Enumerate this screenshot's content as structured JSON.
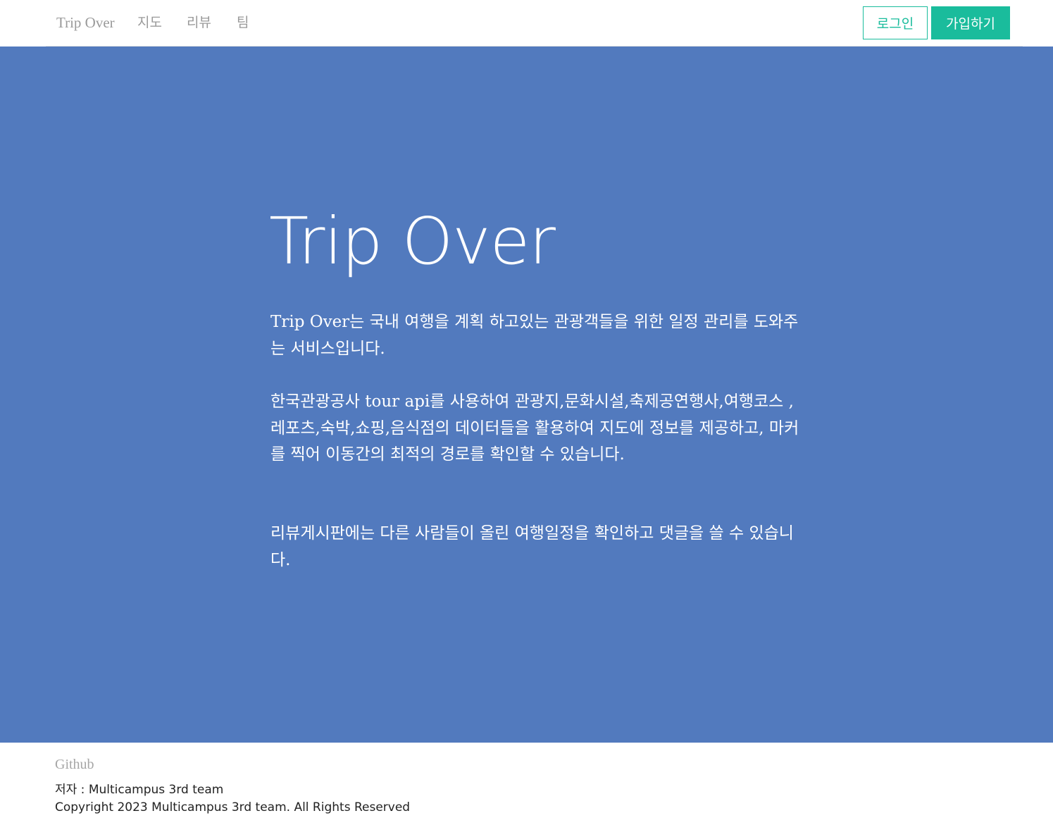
{
  "nav": {
    "brand": "Trip Over",
    "links": [
      "지도",
      "리뷰",
      "팀"
    ],
    "login_label": "로그인",
    "signup_label": "가입하기",
    "accent_color": "#1abc9c"
  },
  "hero": {
    "background_color": "#527abe",
    "title": "Trip Over",
    "paragraphs": [
      "Trip Over는 국내 여행을 계획 하고있는 관광객들을 위한 일정 관리를 도와주는 서비스입니다.",
      "한국관광공사 tour api를 사용하여 관광지,문화시설,축제공연행사,여행코스 ,레포츠,숙박,쇼핑,음식점의 데이터들을 활용하여 지도에 정보를 제공하고, 마커를 찍어 이동간의 최적의 경로를 확인할 수 있습니다.",
      "리뷰게시판에는 다른 사람들이 올린 여행일정을 확인하고 댓글을 쓸 수 있습니다."
    ]
  },
  "footer": {
    "github_label": "Github",
    "author": "저자 : Multicampus 3rd team",
    "copyright": "Copyright 2023 Multicampus 3rd team. All Rights Reserved"
  }
}
